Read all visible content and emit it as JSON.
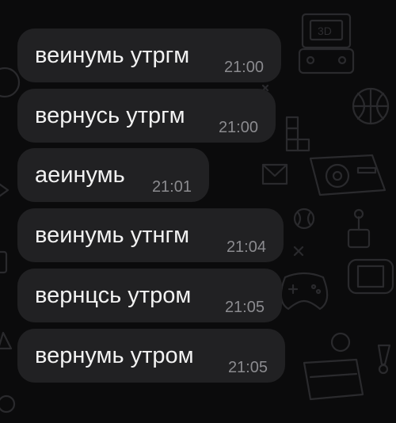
{
  "chat": {
    "messages": [
      {
        "text": "веинумь утргм",
        "time": "21:00"
      },
      {
        "text": "вернусь утргм",
        "time": "21:00"
      },
      {
        "text": "аеинумь",
        "time": "21:01"
      },
      {
        "text": "веинумь утнгм",
        "time": "21:04"
      },
      {
        "text": "вернцсь утром",
        "time": "21:05"
      },
      {
        "text": "вернумь утром",
        "time": "21:05"
      }
    ]
  },
  "wallpaper": {
    "console_label": "3D",
    "icons": [
      "handheld-console-icon",
      "basketball-icon",
      "game-console-icon",
      "gamepad-icon",
      "controller-icon",
      "tetris-block-icon",
      "shuttlecock-icon",
      "envelope-icon",
      "baseball-icon",
      "joystick-icon"
    ]
  }
}
